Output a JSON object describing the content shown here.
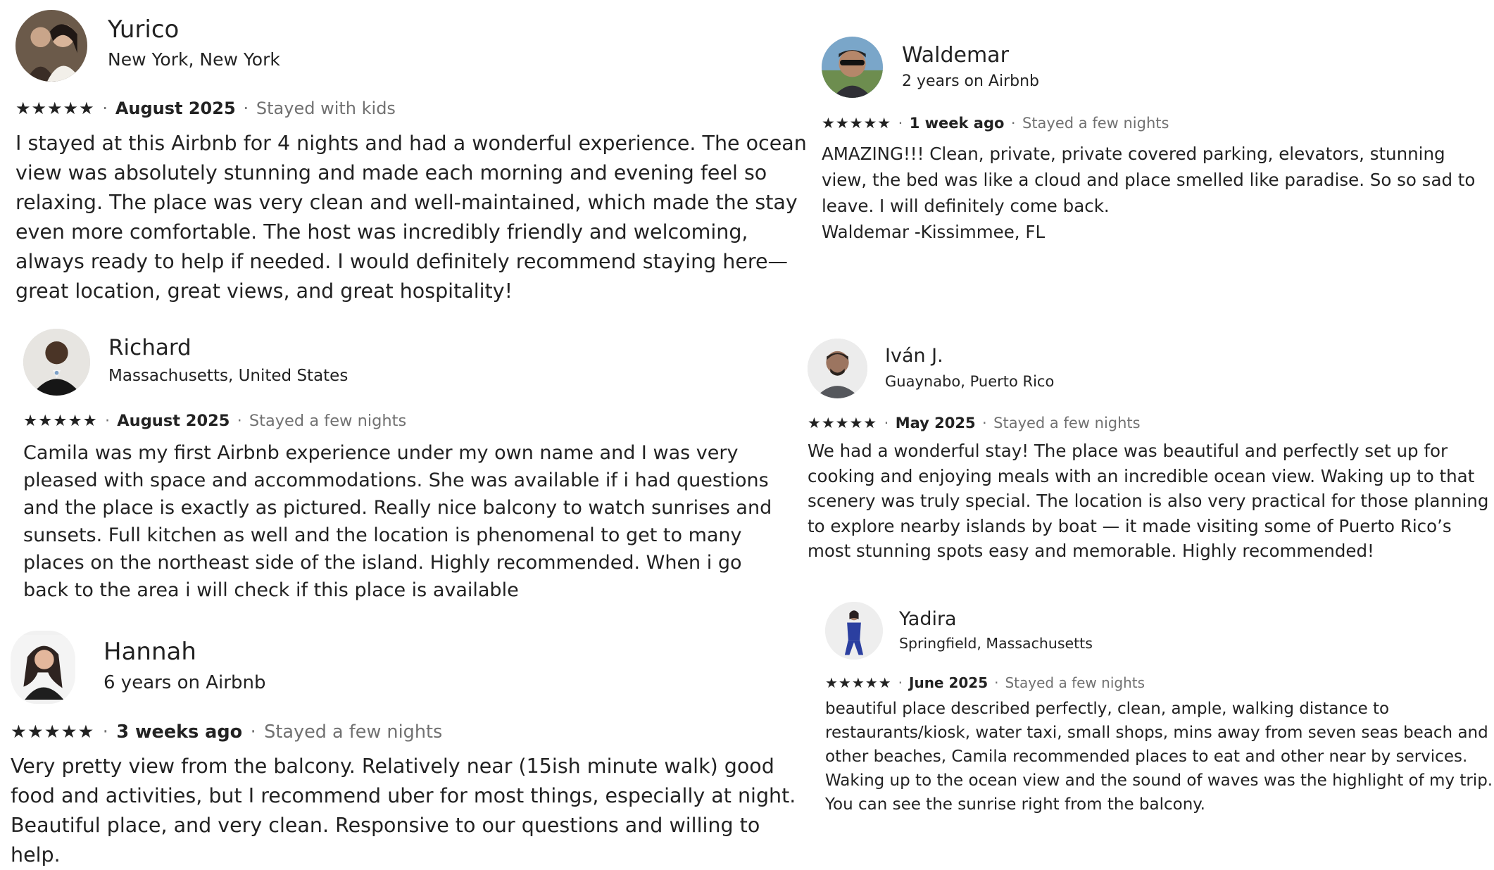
{
  "reviews": [
    {
      "name": "Yurico",
      "subtitle": "New York, New York",
      "rating": 5,
      "stars": "★★★★★",
      "date": "August 2025",
      "stay": "Stayed with kids",
      "text": "I stayed at this Airbnb for 4 nights and had a wonderful experience. The ocean view was absolutely stunning and made each morning and evening feel so relaxing. The place was very clean and well-maintained, which made the stay even more comfortable. The host was incredibly friendly and welcoming, always ready to help if needed. I would definitely recommend staying here—great location, great views, and great hospitality!"
    },
    {
      "name": "Waldemar",
      "subtitle": "2 years on Airbnb",
      "rating": 5,
      "stars": "★★★★★",
      "date": "1 week ago",
      "stay": "Stayed a few nights",
      "text": "AMAZING!!! Clean, private, private covered parking, elevators, stunning view, the bed was like a cloud and place smelled like paradise. So so sad to leave. I will definitely come back.",
      "signature": "Waldemar  -Kissimmee, FL"
    },
    {
      "name": "Richard",
      "subtitle": "Massachusetts, United States",
      "rating": 5,
      "stars": "★★★★★",
      "date": "August 2025",
      "stay": "Stayed a few nights",
      "text": "Camila was my first Airbnb experience under my own name and I was very pleased with space and accommodations. She was available if i had questions and the place is exactly as pictured. Really nice balcony to watch sunrises and sunsets. Full kitchen as well and the location is phenomenal to get to many places on the northeast side of the island. Highly recommended. When i go back to the area i will check if this place is available"
    },
    {
      "name": "Iván J.",
      "subtitle": "Guaynabo, Puerto Rico",
      "rating": 5,
      "stars": "★★★★★",
      "date": "May 2025",
      "stay": "Stayed a few nights",
      "text": "We had a wonderful stay! The place was beautiful and perfectly set up for cooking and enjoying meals with an incredible ocean view. Waking up to that scenery was truly special. The location is also very practical for those planning to explore nearby islands by boat — it made visiting some of Puerto Rico’s most stunning spots easy and memorable. Highly recommended!"
    },
    {
      "name": "Hannah",
      "subtitle": "6 years on Airbnb",
      "rating": 5,
      "stars": "★★★★★",
      "date": "3 weeks ago",
      "stay": "Stayed a few nights",
      "text": "Very pretty view from the balcony. Relatively near (15ish minute walk) good food and activities, but I recommend uber for most things, especially at night. Beautiful place, and very clean. Responsive to our questions and willing to help."
    },
    {
      "name": "Yadira",
      "subtitle": "Springfield, Massachusetts",
      "rating": 5,
      "stars": "★★★★★",
      "date": "June 2025",
      "stay": "Stayed a few nights",
      "text": "beautiful place described perfectly, clean, ample, walking distance to restaurants/kiosk, water taxi, small shops, mins away from seven seas beach and other beaches, Camila recommended places to eat and other near by services. Waking up to the ocean view and the  sound of waves was the highlight of my trip. You can see the sunrise right from the balcony."
    }
  ],
  "separator": "·"
}
